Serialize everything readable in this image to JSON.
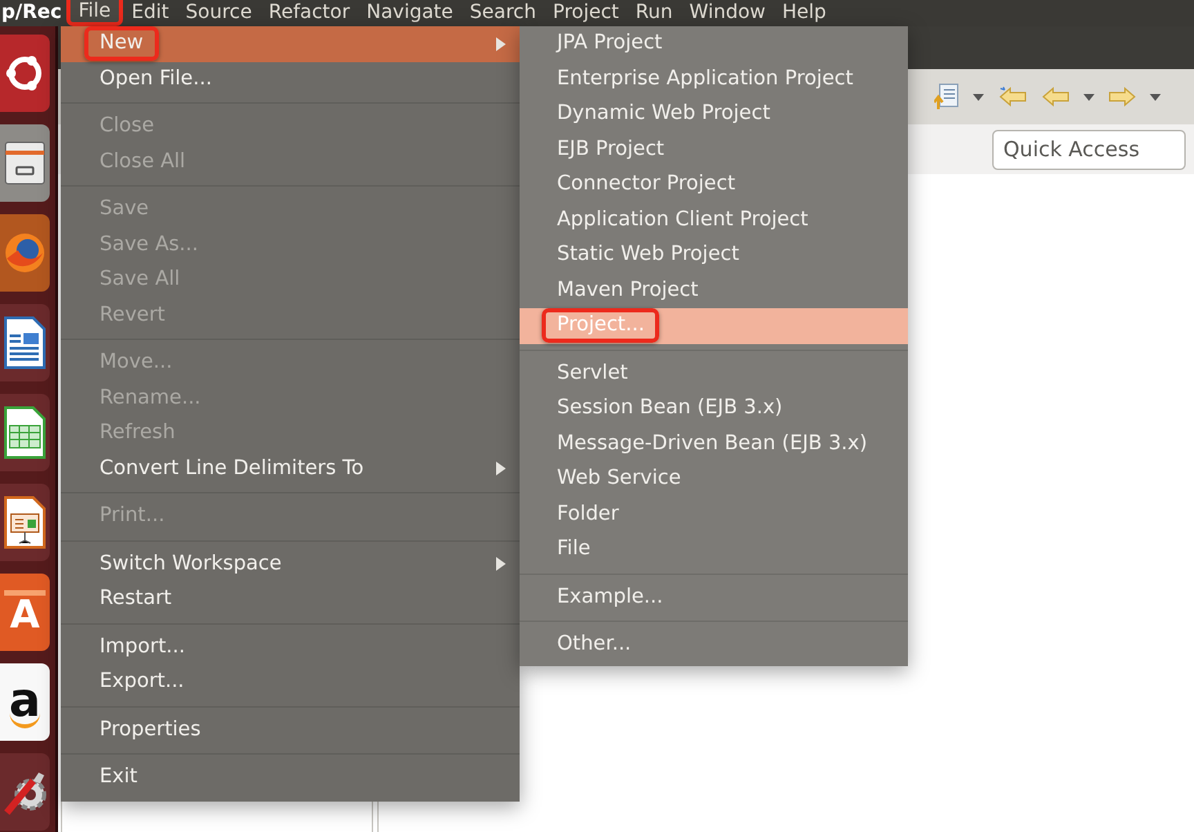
{
  "app_title": "p/Rec",
  "menubar": [
    {
      "label": "File",
      "open": true,
      "callout": true
    },
    {
      "label": "Edit",
      "open": false,
      "callout": false
    },
    {
      "label": "Source",
      "open": false,
      "callout": false
    },
    {
      "label": "Refactor",
      "open": false,
      "callout": false
    },
    {
      "label": "Navigate",
      "open": false,
      "callout": false
    },
    {
      "label": "Search",
      "open": false,
      "callout": false
    },
    {
      "label": "Project",
      "open": false,
      "callout": false
    },
    {
      "label": "Run",
      "open": false,
      "callout": false
    },
    {
      "label": "Window",
      "open": false,
      "callout": false
    },
    {
      "label": "Help",
      "open": false,
      "callout": false
    }
  ],
  "file_menu": {
    "items": [
      {
        "kind": "item",
        "label": "New",
        "enabled": true,
        "selected": true,
        "submenu": true,
        "callout": true
      },
      {
        "kind": "item",
        "label": "Open File...",
        "enabled": true,
        "selected": false,
        "submenu": false,
        "callout": false
      },
      {
        "kind": "separator"
      },
      {
        "kind": "item",
        "label": "Close",
        "enabled": false,
        "selected": false,
        "submenu": false,
        "callout": false
      },
      {
        "kind": "item",
        "label": "Close All",
        "enabled": false,
        "selected": false,
        "submenu": false,
        "callout": false
      },
      {
        "kind": "separator"
      },
      {
        "kind": "item",
        "label": "Save",
        "enabled": false,
        "selected": false,
        "submenu": false,
        "callout": false
      },
      {
        "kind": "item",
        "label": "Save As...",
        "enabled": false,
        "selected": false,
        "submenu": false,
        "callout": false
      },
      {
        "kind": "item",
        "label": "Save All",
        "enabled": false,
        "selected": false,
        "submenu": false,
        "callout": false
      },
      {
        "kind": "item",
        "label": "Revert",
        "enabled": false,
        "selected": false,
        "submenu": false,
        "callout": false
      },
      {
        "kind": "separator"
      },
      {
        "kind": "item",
        "label": "Move...",
        "enabled": false,
        "selected": false,
        "submenu": false,
        "callout": false
      },
      {
        "kind": "item",
        "label": "Rename...",
        "enabled": false,
        "selected": false,
        "submenu": false,
        "callout": false
      },
      {
        "kind": "item",
        "label": "Refresh",
        "enabled": false,
        "selected": false,
        "submenu": false,
        "callout": false
      },
      {
        "kind": "item",
        "label": "Convert Line Delimiters To",
        "enabled": true,
        "selected": false,
        "submenu": true,
        "callout": false
      },
      {
        "kind": "separator"
      },
      {
        "kind": "item",
        "label": "Print...",
        "enabled": false,
        "selected": false,
        "submenu": false,
        "callout": false
      },
      {
        "kind": "separator"
      },
      {
        "kind": "item",
        "label": "Switch Workspace",
        "enabled": true,
        "selected": false,
        "submenu": true,
        "callout": false
      },
      {
        "kind": "item",
        "label": "Restart",
        "enabled": true,
        "selected": false,
        "submenu": false,
        "callout": false
      },
      {
        "kind": "separator"
      },
      {
        "kind": "item",
        "label": "Import...",
        "enabled": true,
        "selected": false,
        "submenu": false,
        "callout": false
      },
      {
        "kind": "item",
        "label": "Export...",
        "enabled": true,
        "selected": false,
        "submenu": false,
        "callout": false
      },
      {
        "kind": "separator"
      },
      {
        "kind": "item",
        "label": "Properties",
        "enabled": true,
        "selected": false,
        "submenu": false,
        "callout": false
      },
      {
        "kind": "separator"
      },
      {
        "kind": "item",
        "label": "Exit",
        "enabled": true,
        "selected": false,
        "submenu": false,
        "callout": false
      }
    ]
  },
  "new_submenu": {
    "items": [
      {
        "kind": "item",
        "label": "JPA Project",
        "enabled": true,
        "selected": false,
        "submenu": false,
        "callout": false
      },
      {
        "kind": "item",
        "label": "Enterprise Application Project",
        "enabled": true,
        "selected": false,
        "submenu": false,
        "callout": false
      },
      {
        "kind": "item",
        "label": "Dynamic Web Project",
        "enabled": true,
        "selected": false,
        "submenu": false,
        "callout": false
      },
      {
        "kind": "item",
        "label": "EJB Project",
        "enabled": true,
        "selected": false,
        "submenu": false,
        "callout": false
      },
      {
        "kind": "item",
        "label": "Connector Project",
        "enabled": true,
        "selected": false,
        "submenu": false,
        "callout": false
      },
      {
        "kind": "item",
        "label": "Application Client Project",
        "enabled": true,
        "selected": false,
        "submenu": false,
        "callout": false
      },
      {
        "kind": "item",
        "label": "Static Web Project",
        "enabled": true,
        "selected": false,
        "submenu": false,
        "callout": false
      },
      {
        "kind": "item",
        "label": "Maven Project",
        "enabled": true,
        "selected": false,
        "submenu": false,
        "callout": false
      },
      {
        "kind": "item",
        "label": "Project...",
        "enabled": true,
        "selected": true,
        "submenu": false,
        "callout": true
      },
      {
        "kind": "separator"
      },
      {
        "kind": "item",
        "label": "Servlet",
        "enabled": true,
        "selected": false,
        "submenu": false,
        "callout": false
      },
      {
        "kind": "item",
        "label": "Session Bean (EJB 3.x)",
        "enabled": true,
        "selected": false,
        "submenu": false,
        "callout": false
      },
      {
        "kind": "item",
        "label": "Message-Driven Bean (EJB 3.x)",
        "enabled": true,
        "selected": false,
        "submenu": false,
        "callout": false
      },
      {
        "kind": "item",
        "label": "Web Service",
        "enabled": true,
        "selected": false,
        "submenu": false,
        "callout": false
      },
      {
        "kind": "item",
        "label": "Folder",
        "enabled": true,
        "selected": false,
        "submenu": false,
        "callout": false
      },
      {
        "kind": "item",
        "label": "File",
        "enabled": true,
        "selected": false,
        "submenu": false,
        "callout": false
      },
      {
        "kind": "separator"
      },
      {
        "kind": "item",
        "label": "Example...",
        "enabled": true,
        "selected": false,
        "submenu": false,
        "callout": false
      },
      {
        "kind": "separator"
      },
      {
        "kind": "item",
        "label": "Other...",
        "enabled": true,
        "selected": false,
        "submenu": false,
        "callout": false
      }
    ]
  },
  "quick_access": {
    "placeholder": "Quick Access"
  },
  "launcher": [
    {
      "kind": "ring"
    },
    {
      "kind": "drawer"
    },
    {
      "kind": "globe"
    },
    {
      "kind": "document"
    },
    {
      "kind": "spreadsheet"
    },
    {
      "kind": "presentation"
    },
    {
      "kind": "bag",
      "glyph": "A"
    },
    {
      "kind": "letter",
      "glyph": "a"
    },
    {
      "kind": "tools"
    }
  ]
}
